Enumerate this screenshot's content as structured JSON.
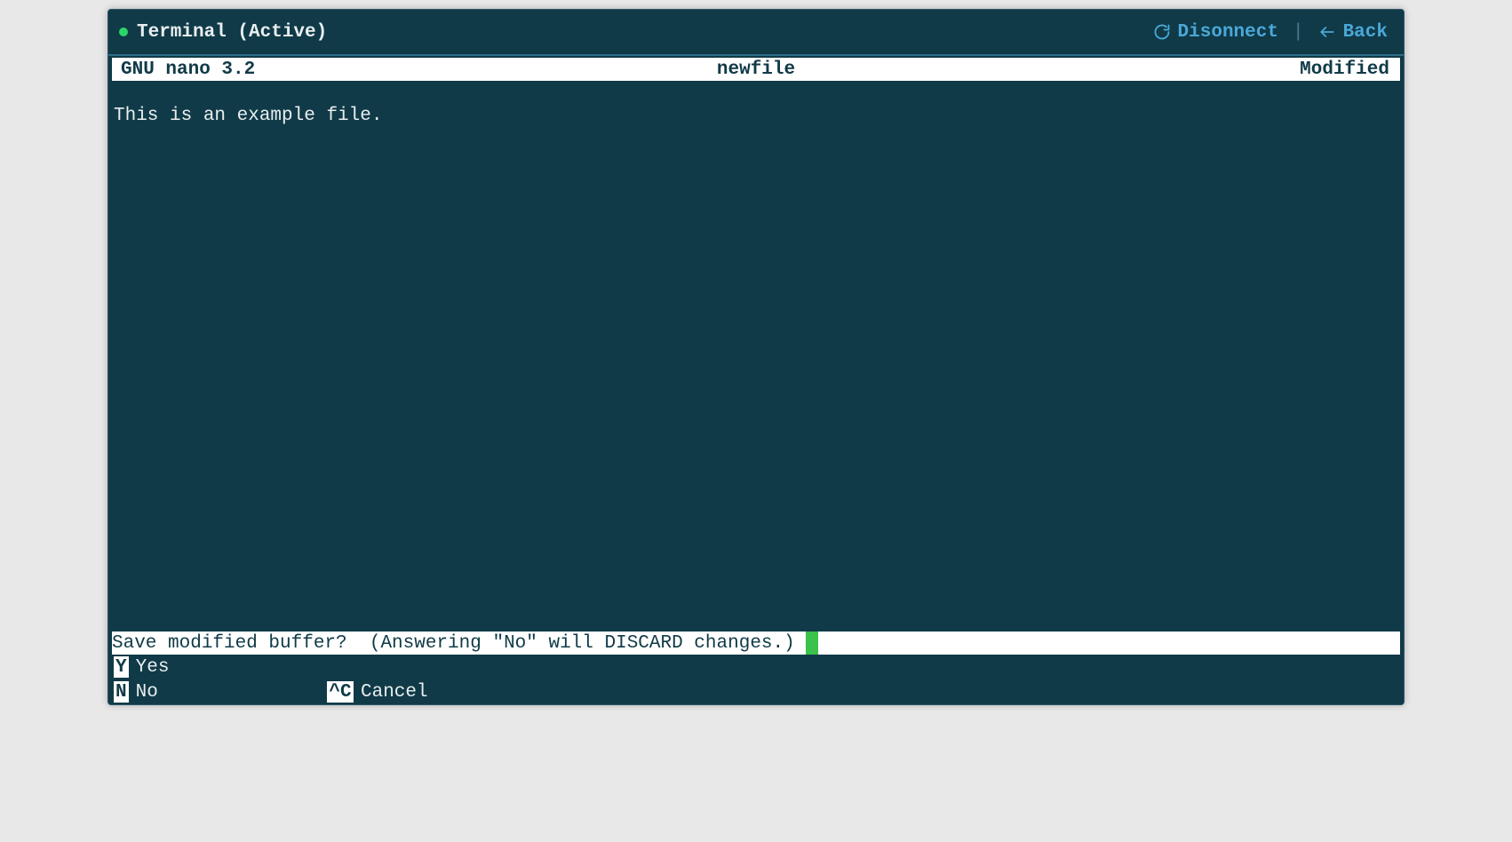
{
  "header": {
    "title": "Terminal (Active)",
    "disconnect": "Disonnect",
    "back": "Back"
  },
  "nano": {
    "version": "GNU nano 3.2",
    "filename": "newfile",
    "status": "Modified",
    "body": "This is an example file."
  },
  "prompt": {
    "text": "Save modified buffer?  (Answering \"No\" will DISCARD changes.) "
  },
  "shortcuts": {
    "row1": [
      {
        "key": " Y",
        "label": "Yes"
      }
    ],
    "row2": [
      {
        "key": " N",
        "label": "No"
      },
      {
        "key": "^C",
        "label": "Cancel"
      }
    ]
  }
}
